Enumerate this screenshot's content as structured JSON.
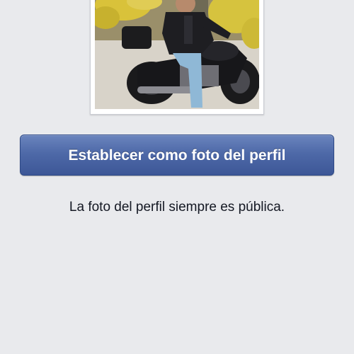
{
  "profile_photo": {
    "alt": "Profile photo preview"
  },
  "actions": {
    "set_profile_photo_label": "Establecer como foto del perfil"
  },
  "notice": {
    "privacy_text": "La foto del perfil siempre es pública."
  },
  "colors": {
    "page_background": "#e9eaed",
    "button_top": "#6a84bd",
    "button_bottom": "#3d5797",
    "button_text": "#ffffff",
    "notice_text": "#141823"
  }
}
